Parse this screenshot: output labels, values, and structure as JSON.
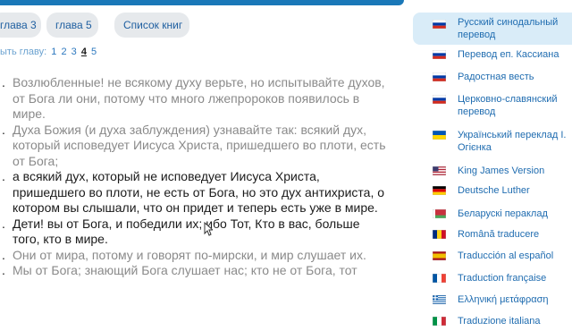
{
  "tabs": [
    {
      "label": "глава 3"
    },
    {
      "label": "глава 5"
    },
    {
      "label": "Список книг"
    }
  ],
  "chapter_nav": {
    "label": "ыть главу:",
    "chapters": [
      "1",
      "2",
      "3",
      "4",
      "5"
    ],
    "current": "4"
  },
  "verses": [
    {
      "text": "Возлюбленные! не всякому духу верьте, но испытывайте духов, от Бога ли они, потому что много лжепророков появилось в мире.",
      "highlighted": false
    },
    {
      "text": "Духа Божия (и духа заблуждения) узнавайте так: всякий дух, который исповедует Иисуса Христа, пришедшего во плоти, есть от Бога;",
      "highlighted": false
    },
    {
      "text": "а всякий дух, который не исповедует Иисуса Христа, пришедшего во плоти, не есть от Бога, но это дух антихриста, о котором вы слышали, что он придет и теперь есть уже в мире.",
      "highlighted": true
    },
    {
      "text": "Дети! вы от Бога, и победили их; ибо Тот, Кто в вас, больше того, кто в мире.",
      "highlighted": true
    },
    {
      "text": "Они от мира, потому и говорят по-мирски, и мир слушает их.",
      "highlighted": false
    },
    {
      "text": "Мы от Бога; знающий Бога слушает нас; кто не от Бога, тот",
      "highlighted": false
    }
  ],
  "translations": [
    {
      "label": "Русский синодальный перевод",
      "flag": "russia",
      "active": true
    },
    {
      "label": "Перевод еп.  Кассиана",
      "flag": "russia",
      "active": false
    },
    {
      "label": "Радостная весть",
      "flag": "russia",
      "active": false
    },
    {
      "label": "Церковно-славянский перевод",
      "flag": "russia",
      "active": false
    },
    {
      "label": "Український переклад І. Огієнка",
      "flag": "ukraine",
      "active": false
    },
    {
      "label": "King James Version",
      "flag": "usa",
      "active": false
    },
    {
      "label": "Deutsche Luther",
      "flag": "germany",
      "active": false
    },
    {
      "label": "Беларускі пераклад",
      "flag": "belarus",
      "active": false
    },
    {
      "label": "Română traducere",
      "flag": "romania",
      "active": false
    },
    {
      "label": "Traducción al español",
      "flag": "spain",
      "active": false
    },
    {
      "label": "Traduction française",
      "flag": "france",
      "active": false
    },
    {
      "label": "Ελληνική μετάφραση",
      "flag": "greece",
      "active": false
    },
    {
      "label": "Traduzione italiana",
      "flag": "italy",
      "active": false
    }
  ],
  "colors": {
    "accent": "#1a78b8",
    "link": "#1f6cb0",
    "active_bg": "#d9ecf8"
  }
}
